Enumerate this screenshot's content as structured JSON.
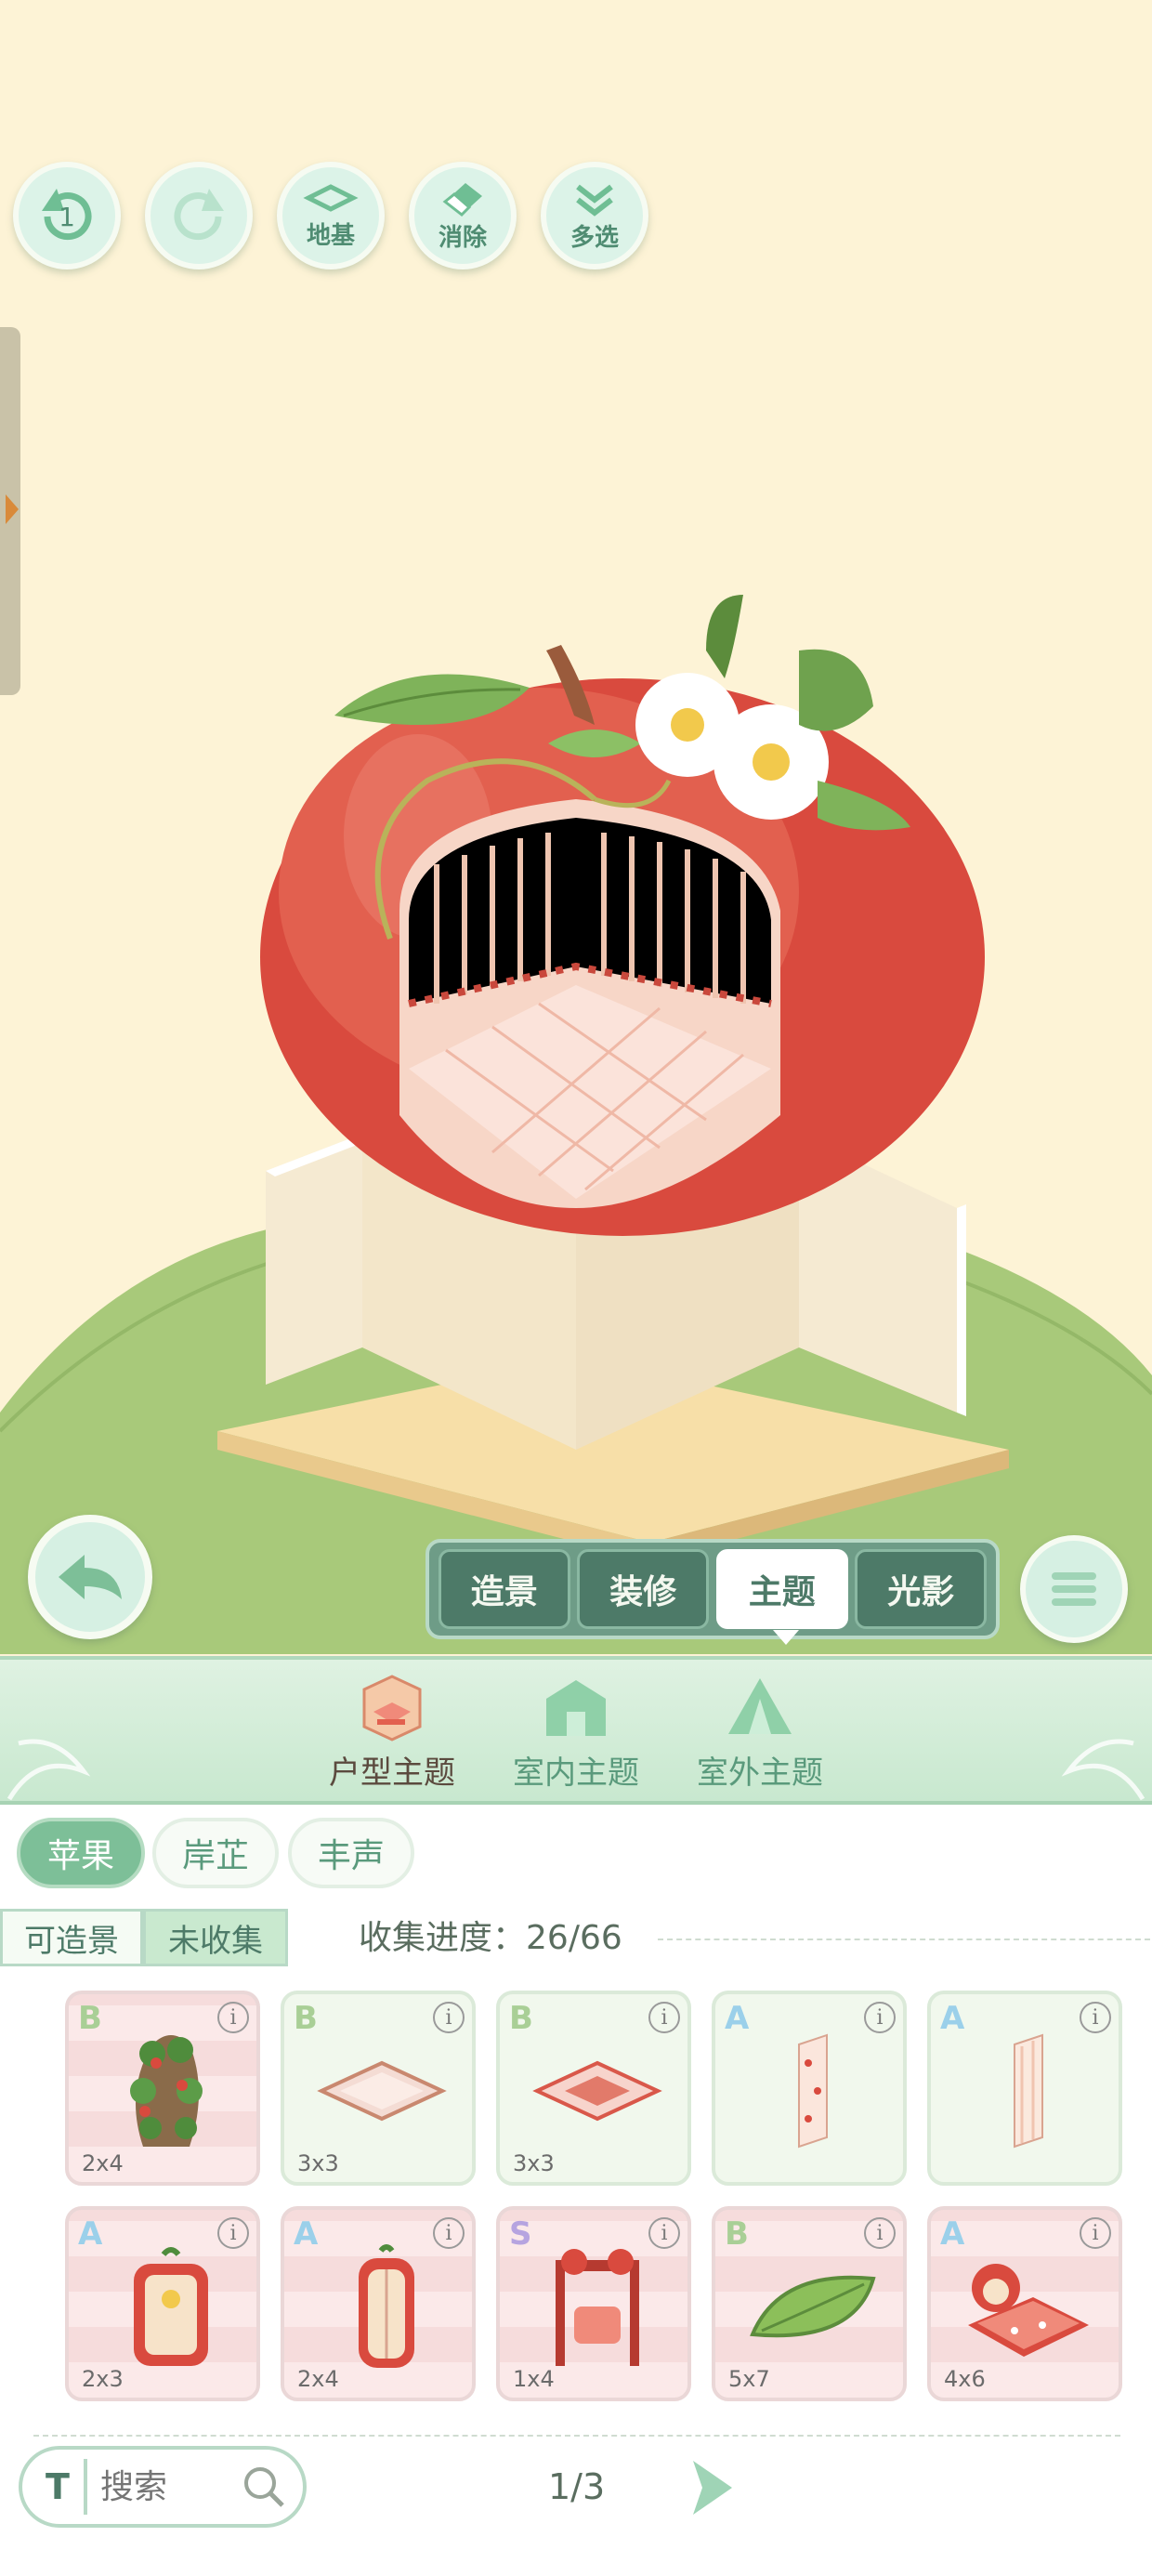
{
  "toolbar": {
    "undo_count": "1",
    "foundation_label": "地基",
    "erase_label": "消除",
    "multiselect_label": "多选"
  },
  "mode_tabs": [
    {
      "label": "造景",
      "active": false
    },
    {
      "label": "装修",
      "active": false
    },
    {
      "label": "主题",
      "active": true
    },
    {
      "label": "光影",
      "active": false
    }
  ],
  "theme_categories": [
    {
      "label": "户型主题",
      "icon": "house-theme-icon",
      "active": true
    },
    {
      "label": "室内主题",
      "icon": "indoor-theme-icon",
      "active": false
    },
    {
      "label": "室外主题",
      "icon": "tent-icon",
      "active": false
    }
  ],
  "chips": [
    {
      "label": "苹果",
      "active": true
    },
    {
      "label": "岸芷",
      "active": false
    },
    {
      "label": "丰声",
      "active": false
    }
  ],
  "filters": {
    "buildable": "可造景",
    "uncollected": "未收集"
  },
  "progress": {
    "label": "收集进度：",
    "value": "26/66",
    "collected": 26,
    "total": 66
  },
  "items": [
    {
      "rarity": "B",
      "size": "2x4",
      "icon": "vine-arch-icon",
      "bg": "pink"
    },
    {
      "rarity": "B",
      "size": "3x3",
      "icon": "floor-tile-icon",
      "bg": "green"
    },
    {
      "rarity": "B",
      "size": "3x3",
      "icon": "floor-tile-red-icon",
      "bg": "green"
    },
    {
      "rarity": "A",
      "size": "",
      "icon": "wallpaper-strawberry-icon",
      "bg": "green"
    },
    {
      "rarity": "A",
      "size": "",
      "icon": "wallpaper-stripe-icon",
      "bg": "green"
    },
    {
      "rarity": "A",
      "size": "2x3",
      "icon": "apple-fridge-icon",
      "bg": "pink"
    },
    {
      "rarity": "A",
      "size": "2x4",
      "icon": "apple-wardrobe-icon",
      "bg": "pink"
    },
    {
      "rarity": "S",
      "size": "1x4",
      "icon": "apple-swing-icon",
      "bg": "pink"
    },
    {
      "rarity": "B",
      "size": "5x7",
      "icon": "leaf-rug-icon",
      "bg": "pink"
    },
    {
      "rarity": "A",
      "size": "4x6",
      "icon": "apple-bed-icon",
      "bg": "pink"
    }
  ],
  "search": {
    "font_label": "T",
    "placeholder": "搜索"
  },
  "pagination": {
    "current": "1/3"
  },
  "colors": {
    "accent_green": "#7dbf98",
    "apple_red": "#d94a3e",
    "background_cream": "#fdf3d6"
  }
}
